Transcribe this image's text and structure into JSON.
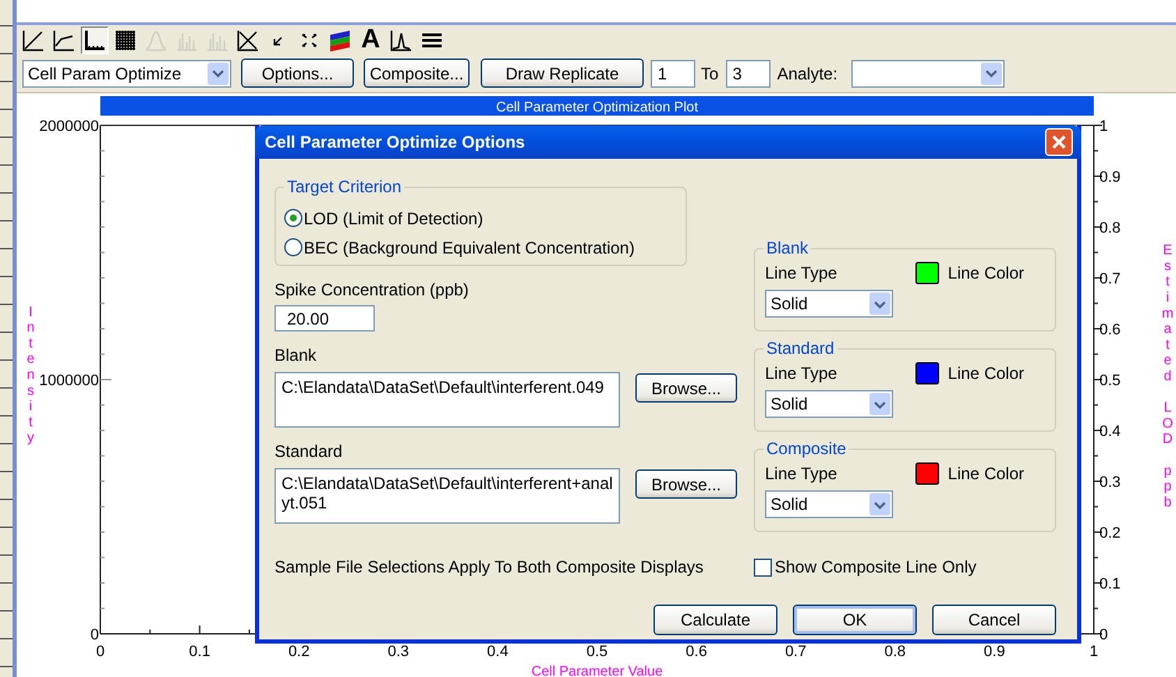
{
  "toolbar": {
    "icons": [
      {
        "kind": "line-chart",
        "selected": false,
        "disabled": false
      },
      {
        "kind": "step-chart",
        "selected": false,
        "disabled": false
      },
      {
        "kind": "axis-chart",
        "selected": true,
        "disabled": false
      },
      {
        "kind": "grid",
        "selected": false,
        "disabled": false
      },
      {
        "kind": "bell-curve",
        "selected": false,
        "disabled": true
      },
      {
        "kind": "bar-chart",
        "selected": false,
        "disabled": true
      },
      {
        "kind": "bar-chart",
        "selected": false,
        "disabled": true
      },
      {
        "kind": "cross-box",
        "selected": false,
        "disabled": false
      },
      {
        "kind": "corner-arrow",
        "selected": false,
        "disabled": false
      },
      {
        "kind": "four-arrows",
        "selected": false,
        "disabled": false
      },
      {
        "kind": "color-stripes",
        "selected": false,
        "disabled": false
      },
      {
        "kind": "letter",
        "glyph": "A",
        "selected": false,
        "disabled": false
      },
      {
        "kind": "peak-chart",
        "selected": false,
        "disabled": false
      },
      {
        "kind": "lines",
        "selected": false,
        "disabled": false
      }
    ]
  },
  "controls": {
    "plot_type": "Cell Param Optimize",
    "buttons": [
      "Options...",
      "Composite...",
      "Draw Replicate"
    ],
    "range_from": "1",
    "range_to_label": "To",
    "range_to": "3",
    "analyte_label": "Analyte:"
  },
  "plot": {
    "title": "Cell Parameter Optimization Plot",
    "y_label": "Intensity",
    "y_ticks": [
      "2000000",
      "1000000",
      "0"
    ],
    "x_label": "Cell Parameter Value",
    "x_ticks": [
      "0",
      "0.1",
      "0.2",
      "0.3",
      "0.4",
      "0.5",
      "0.6",
      "0.7",
      "0.8",
      "0.9",
      "1"
    ],
    "right_label": "Estimated LOD ppb",
    "right_ticks": [
      "1",
      "0.9",
      "0.8",
      "0.7",
      "0.6",
      "0.5",
      "0.4",
      "0.3",
      "0.2",
      "0.1",
      "0"
    ]
  },
  "dialog": {
    "title": "Cell Parameter Optimize Options",
    "target_criterion": {
      "legend": "Target Criterion",
      "options": [
        {
          "label": "LOD (Limit of Detection)",
          "selected": true
        },
        {
          "label": "BEC (Background Equivalent Concentration)",
          "selected": false
        }
      ]
    },
    "spike": {
      "label": "Spike Concentration (ppb)",
      "value": "20.00"
    },
    "files": [
      {
        "label": "Blank",
        "path": "C:\\Elandata\\DataSet\\Default\\interferent.049",
        "button": "Browse..."
      },
      {
        "label": "Standard",
        "path": "C:\\Elandata\\DataSet\\Default\\interferent+analyt.051",
        "button": "Browse..."
      }
    ],
    "line_groups": [
      {
        "legend": "Blank",
        "line_type_label": "Line Type",
        "line_type": "Solid",
        "color_label": "Line Color",
        "color": "#00ff00"
      },
      {
        "legend": "Standard",
        "line_type_label": "Line Type",
        "line_type": "Solid",
        "color_label": "Line Color",
        "color": "#0000ff"
      },
      {
        "legend": "Composite",
        "line_type_label": "Line Type",
        "line_type": "Solid",
        "color_label": "Line Color",
        "color": "#ff0000"
      }
    ],
    "note": "Sample File Selections Apply To Both Composite Displays",
    "show_composite_only": {
      "label": "Show Composite Line Only",
      "checked": false
    },
    "buttons": [
      {
        "label": "Calculate",
        "default": false
      },
      {
        "label": "OK",
        "default": true
      },
      {
        "label": "Cancel",
        "default": false
      }
    ]
  }
}
